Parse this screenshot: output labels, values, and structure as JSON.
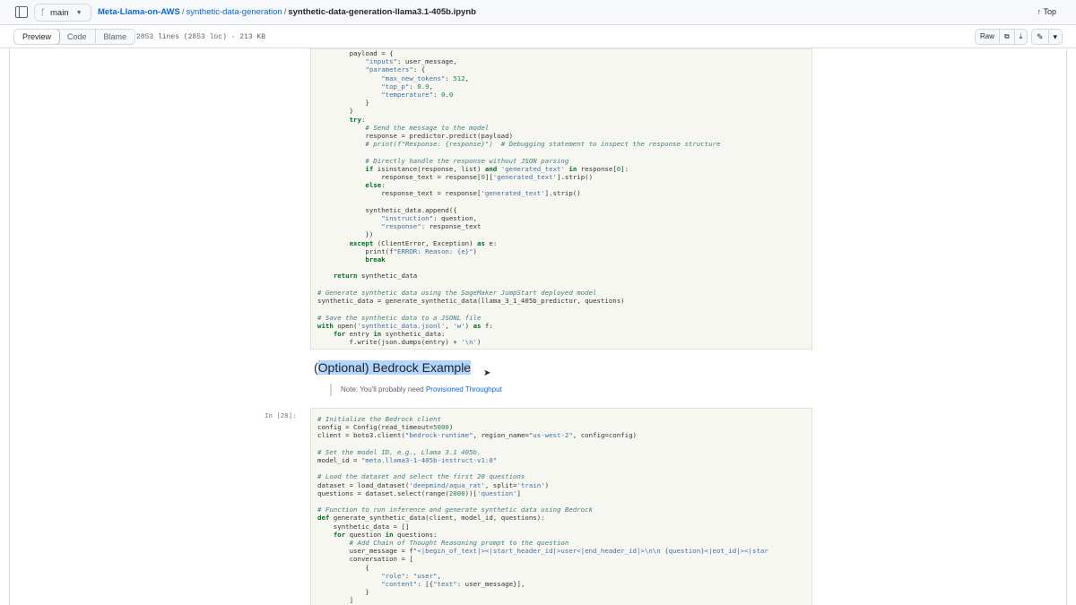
{
  "topbar": {
    "branch": "main",
    "repo": "Meta-Llama-on-AWS",
    "folder": "synthetic-data-generation",
    "separator": "/",
    "file": "synthetic-data-generation-llama3.1-405b.ipynb",
    "top_label": "↑ Top"
  },
  "toolbar": {
    "tabs": [
      "Preview",
      "Code",
      "Blame"
    ],
    "file_meta": "2853 lines (2853 loc) · 213 KB",
    "raw_label": "Raw",
    "copy_icon": "⧉",
    "download_icon": "⤓",
    "edit_icon": "✎",
    "more_icon": "▾"
  },
  "notebook": {
    "markdown_heading_selected": "Optional) Bedrock Example",
    "markdown_heading_prefix": "(",
    "note_text": "Note: You'll probably need ",
    "note_link": "Provisioned Throughput",
    "cell2_prompt": "In [28]:"
  },
  "icons": {
    "sidebar": "sidebar-toggle-icon",
    "branch": "git-branch-icon",
    "cursor": "mouse-cursor-icon"
  },
  "colors": {
    "link": "#0969da",
    "cell_bg": "#f7f7f2",
    "selection": "#b4d5fe"
  }
}
